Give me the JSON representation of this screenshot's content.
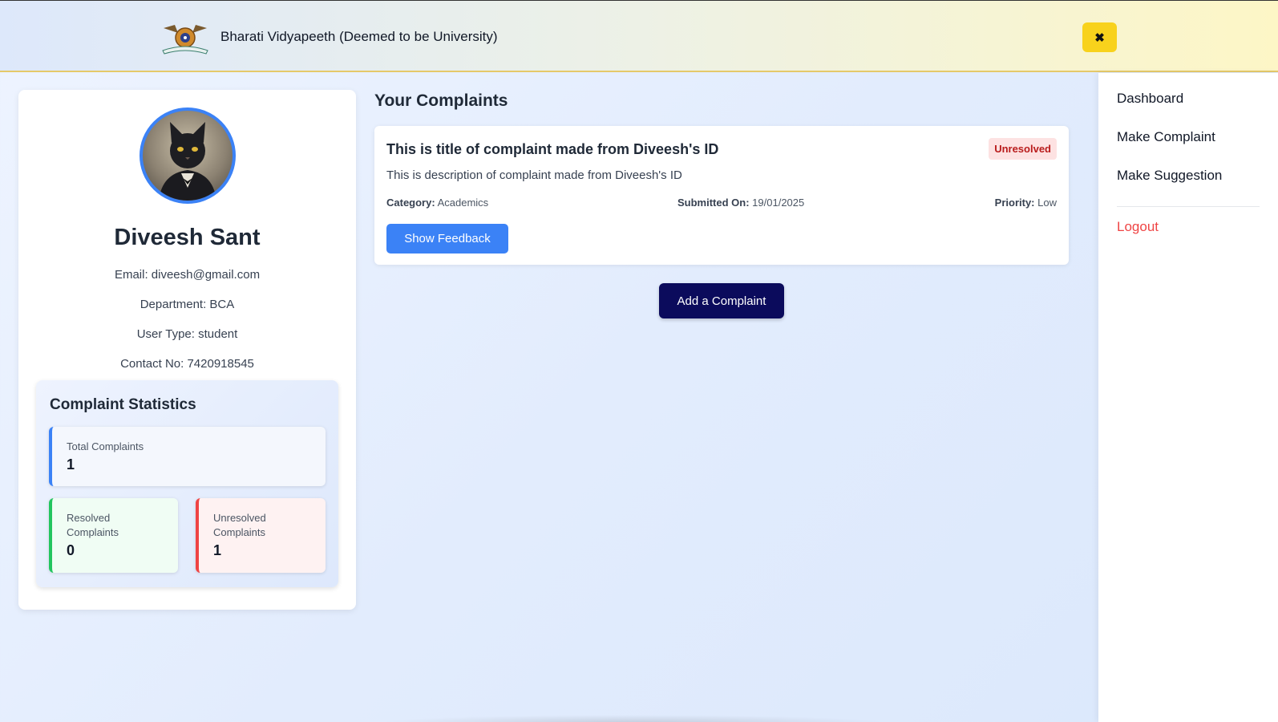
{
  "header": {
    "title": "Bharati Vidyapeeth (Deemed to be University)",
    "logo_icon": "university-emblem-icon",
    "close_label": "✖"
  },
  "profile": {
    "name": "Diveesh Sant",
    "email_line": "Email: diveesh@gmail.com",
    "department_line": "Department: BCA",
    "user_type_line": "User Type: student",
    "contact_line": "Contact No: 7420918545",
    "avatar_icon": "avatar-cat-icon"
  },
  "stats": {
    "title": "Complaint Statistics",
    "total": {
      "label": "Total Complaints",
      "value": "1"
    },
    "resolved": {
      "label": "Resolved Complaints",
      "value": "0"
    },
    "unresolved": {
      "label": "Unresolved Complaints",
      "value": "1"
    }
  },
  "complaints": {
    "heading": "Your Complaints",
    "items": [
      {
        "title": "This is title of complaint made from Diveesh's ID",
        "status": "Unresolved",
        "description": "This is description of complaint made from Diveesh's ID",
        "category_label": "Category:",
        "category": "Academics",
        "submitted_label": "Submitted On:",
        "submitted": "19/01/2025",
        "priority_label": "Priority:",
        "priority": "Low",
        "feedback_label": "Show Feedback"
      }
    ],
    "add_label": "Add a Complaint"
  },
  "menu": {
    "items": [
      {
        "label": "Dashboard"
      },
      {
        "label": "Make Complaint"
      },
      {
        "label": "Make Suggestion"
      }
    ],
    "logout_label": "Logout"
  },
  "colors": {
    "accent": "#3b82f6",
    "close_button": "#f8d21c",
    "add_button": "#0b0b5c",
    "unresolved": "#ef4444",
    "resolved": "#22c55e"
  }
}
